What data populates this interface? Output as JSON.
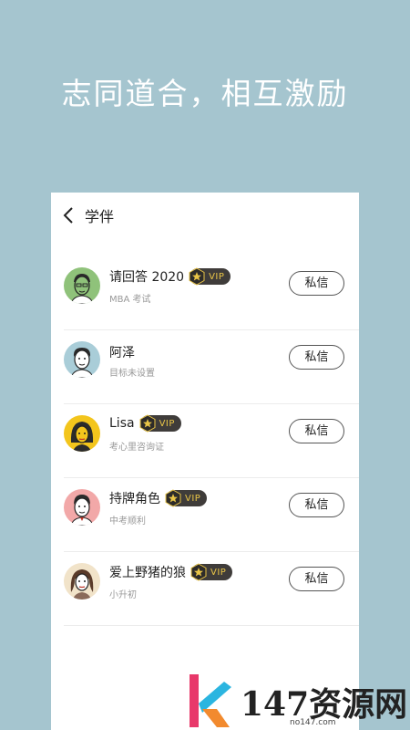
{
  "headline": "志同道合，相互激励",
  "header": {
    "title": "学伴"
  },
  "vip_label": "VIP",
  "button_label": "私信",
  "partners": [
    {
      "name": "请回答 2020",
      "subtitle": "MBA 考试",
      "vip": true,
      "avatar_color": "#8fc27a"
    },
    {
      "name": "阿泽",
      "subtitle": "目标未设置",
      "vip": false,
      "avatar_color": "#a9cdd8"
    },
    {
      "name": "Lisa",
      "subtitle": "考心里咨询证",
      "vip": true,
      "avatar_color": "#f3c51c"
    },
    {
      "name": "持牌角色",
      "subtitle": "中考顺利",
      "vip": true,
      "avatar_color": "#f2a8a8"
    },
    {
      "name": "爱上野猪的狼",
      "subtitle": "小升初",
      "vip": true,
      "avatar_color": "#f1e3c9"
    }
  ],
  "watermark": {
    "text": "147资源网",
    "url": "no147.com"
  },
  "colors": {
    "background": "#a5c5cf",
    "vip_badge": "#3f3c3a",
    "vip_text": "#e9c547"
  }
}
